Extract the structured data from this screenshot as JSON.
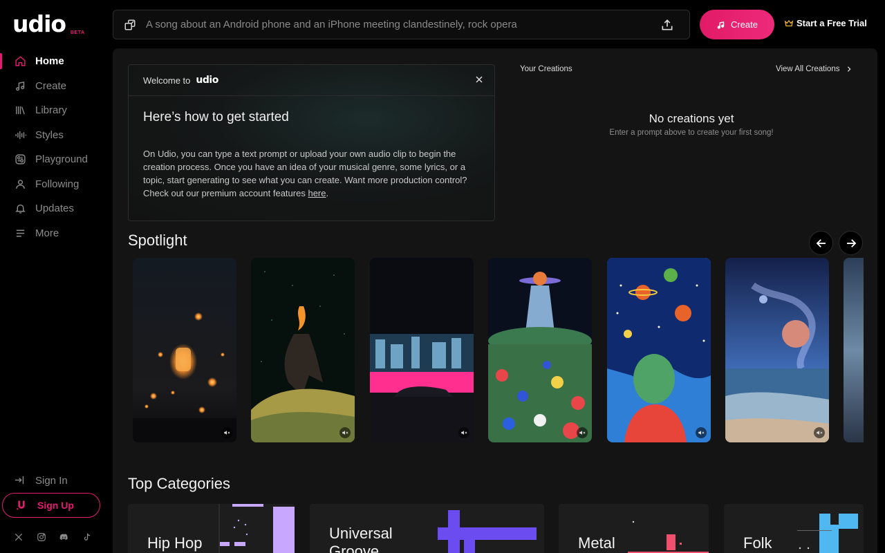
{
  "app": {
    "logo_text": "udio",
    "logo_badge": "BETA"
  },
  "sidebar": {
    "items": [
      {
        "label": "Home",
        "icon": "home-icon",
        "active": true
      },
      {
        "label": "Create",
        "icon": "music-note-icon"
      },
      {
        "label": "Library",
        "icon": "library-icon"
      },
      {
        "label": "Styles",
        "icon": "waveform-icon"
      },
      {
        "label": "Playground",
        "icon": "atom-icon"
      },
      {
        "label": "Following",
        "icon": "user-icon"
      },
      {
        "label": "Updates",
        "icon": "bell-icon"
      },
      {
        "label": "More",
        "icon": "menu-icon"
      }
    ],
    "sign_in": "Sign In",
    "sign_up": "Sign Up",
    "socials": [
      "x-icon",
      "instagram-icon",
      "discord-icon",
      "tiktok-icon"
    ]
  },
  "topbar": {
    "prompt_placeholder": "A song about an Android phone and an iPhone meeting clandestinely, rock opera",
    "create_label": "Create",
    "trial_label": "Start a Free Trial"
  },
  "welcome": {
    "heading_prefix": "Welcome to",
    "brand": "udio",
    "title": "Here’s how to get started",
    "body": "On Udio, you can type a text prompt or upload your own audio clip to begin the creation process. Once you have an idea of your musical genre, some lyrics, or a topic, start generating to see what you can create. Want more production control? Check out our premium account features",
    "link": "here",
    "body_end": "."
  },
  "your_creations": {
    "title": "Your Creations",
    "view_all": "View All Creations",
    "empty_title": "No creations yet",
    "empty_subtitle": "Enter a prompt above to create your first song!"
  },
  "spotlight": {
    "title": "Spotlight",
    "cards": [
      {
        "art": "sky-lanterns-night"
      },
      {
        "art": "burning-rider-field"
      },
      {
        "art": "neon-city-car"
      },
      {
        "art": "ufo-flower-field"
      },
      {
        "art": "cosmic-girl-planets"
      },
      {
        "art": "nebula-beach"
      }
    ]
  },
  "top_categories": {
    "title": "Top Categories",
    "items": [
      {
        "label": "Hip Hop"
      },
      {
        "label": "Universal Groove"
      },
      {
        "label": "Metal"
      },
      {
        "label": "Folk"
      }
    ]
  },
  "colors": {
    "accent": "#e41c6f",
    "background": "#000000",
    "panel": "#141414"
  }
}
